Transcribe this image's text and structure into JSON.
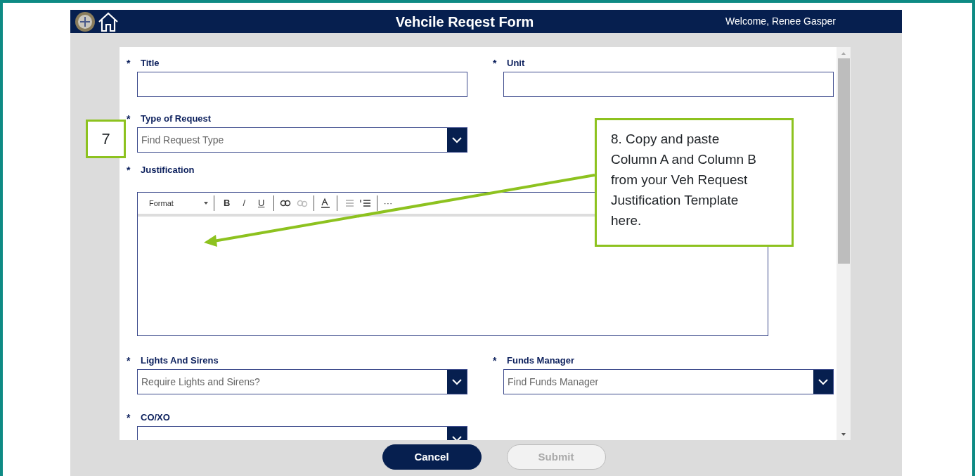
{
  "header": {
    "title": "Vehcile Reqest Form",
    "welcome": "Welcome, Renee Gasper"
  },
  "rows": [
    {
      "fields": [
        {
          "kind": "text",
          "marker": "*",
          "label": "Title"
        },
        {
          "kind": "text",
          "marker": "*",
          "label": "Unit"
        }
      ]
    },
    {
      "fields": [
        {
          "kind": "combo",
          "marker": "*",
          "label": "Type of Request",
          "placeholder": "Find Request Type"
        }
      ]
    },
    {
      "fields": [
        {
          "kind": "editor",
          "marker": "*",
          "label": "Justification"
        }
      ]
    },
    {
      "fields": [
        {
          "kind": "combo",
          "marker": "*",
          "label": "Lights And Sirens",
          "placeholder": "Require Lights and Sirens?"
        },
        {
          "kind": "combo",
          "marker": "*",
          "label": "Funds Manager",
          "placeholder": "Find Funds Manager"
        }
      ]
    },
    {
      "fields": [
        {
          "kind": "combo",
          "marker": "*",
          "label": "CO/XO"
        }
      ]
    }
  ],
  "toolbar": {
    "format": "Format",
    "chars": [
      "B",
      "/",
      "U"
    ],
    "more": "···"
  },
  "buttons": [
    {
      "label": "Cancel",
      "disabled": false
    },
    {
      "label": "Submit",
      "disabled": true
    }
  ],
  "annotations": [
    {
      "kind": "step",
      "text": "7"
    },
    {
      "kind": "callout",
      "text": "8. Copy and paste Column A and Column B from your Veh Request Justification Template here."
    }
  ]
}
